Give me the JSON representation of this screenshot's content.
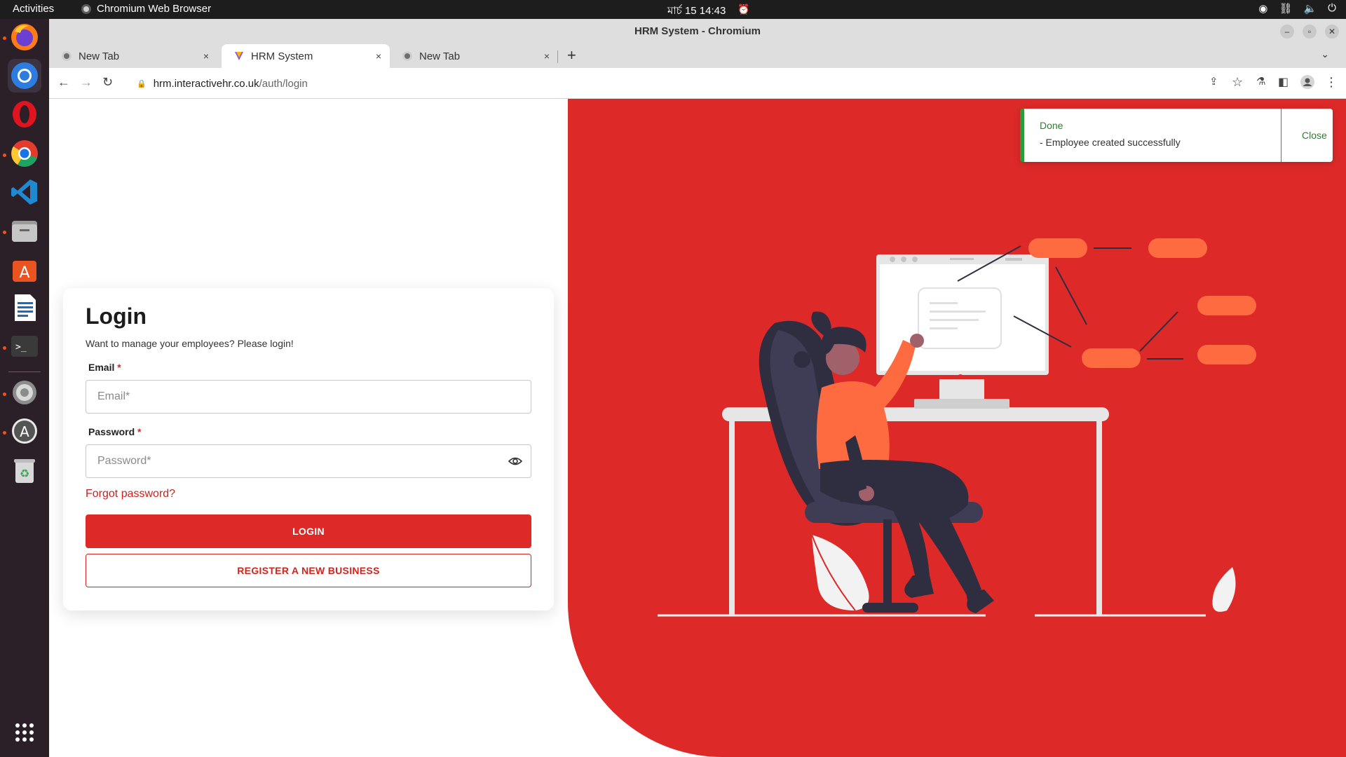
{
  "system": {
    "activities": "Activities",
    "app_menu": "Chromium Web Browser",
    "clock": "মার্চ 15  14:43"
  },
  "dock": {
    "apps": [
      "firefox-icon",
      "chromium-icon",
      "opera-icon",
      "chrome-icon",
      "vscode-icon",
      "files-icon",
      "software-icon",
      "writer-icon",
      "terminal-icon",
      "settings-icon",
      "updater-icon",
      "trash-icon",
      "app-grid-icon"
    ]
  },
  "browser": {
    "window_title": "HRM System - Chromium",
    "tabs": [
      {
        "label": "New Tab",
        "close": "×"
      },
      {
        "label": "HRM System",
        "close": "×"
      },
      {
        "label": "New Tab",
        "close": "×"
      }
    ],
    "new_tab": "+",
    "url_host": "hrm.interactivehr.co.uk",
    "url_path": "/auth/login"
  },
  "login": {
    "title": "Login",
    "subtitle": "Want to manage your employees? Please login!",
    "email_label": "Email",
    "email_placeholder": "Email*",
    "password_label": "Password",
    "password_placeholder": "Password*",
    "required_mark": "*",
    "forgot": "Forgot password?",
    "login_button": "LOGIN",
    "register_button": "REGISTER A NEW BUSINESS"
  },
  "toast": {
    "title": "Done",
    "message": "- Employee created successfully",
    "close": "Close",
    "accent": "#2e9a3a"
  },
  "colors": {
    "brand": "#dd2a29",
    "illustration_orange": "#ff6b40",
    "dark_navy": "#2f2e41"
  }
}
